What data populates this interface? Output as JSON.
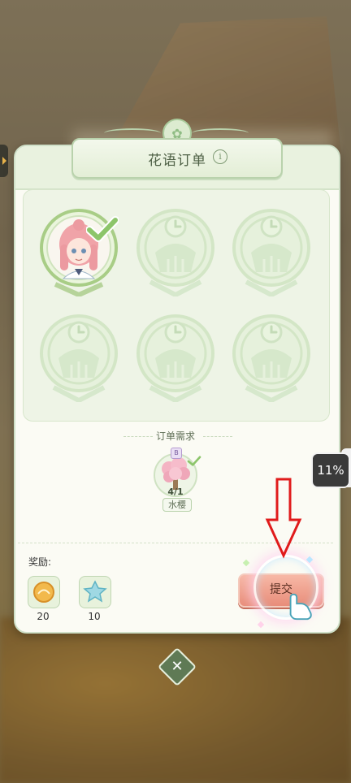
{
  "dialog": {
    "title": "花语订单",
    "info_icon": "info-icon"
  },
  "slots": [
    {
      "state": "completed",
      "character": "pink-haired girl",
      "check_icon": "checkmark-icon"
    },
    {
      "state": "locked",
      "icon": "clock-icon"
    },
    {
      "state": "locked",
      "icon": "clock-icon"
    },
    {
      "state": "locked",
      "icon": "clock-icon"
    },
    {
      "state": "locked",
      "icon": "clock-icon"
    },
    {
      "state": "locked",
      "icon": "clock-icon"
    }
  ],
  "requirements": {
    "label": "订单需求",
    "items": [
      {
        "name": "水樱",
        "count": "4/1",
        "grade": "B",
        "icon": "cherry-blossom-tree-icon"
      }
    ]
  },
  "rewards": {
    "label": "奖励:",
    "items": [
      {
        "icon": "gold-coin-icon",
        "amount": "20"
      },
      {
        "icon": "exp-star-icon",
        "amount": "10"
      }
    ]
  },
  "submit_button": {
    "label": "提交"
  },
  "progress_badge": {
    "value": "11%"
  },
  "close_icon": "close-icon",
  "colors": {
    "panel_accent": "#b9d2ac",
    "submit": "#e88d7a",
    "locked_emblem": "#cfe3c4"
  }
}
